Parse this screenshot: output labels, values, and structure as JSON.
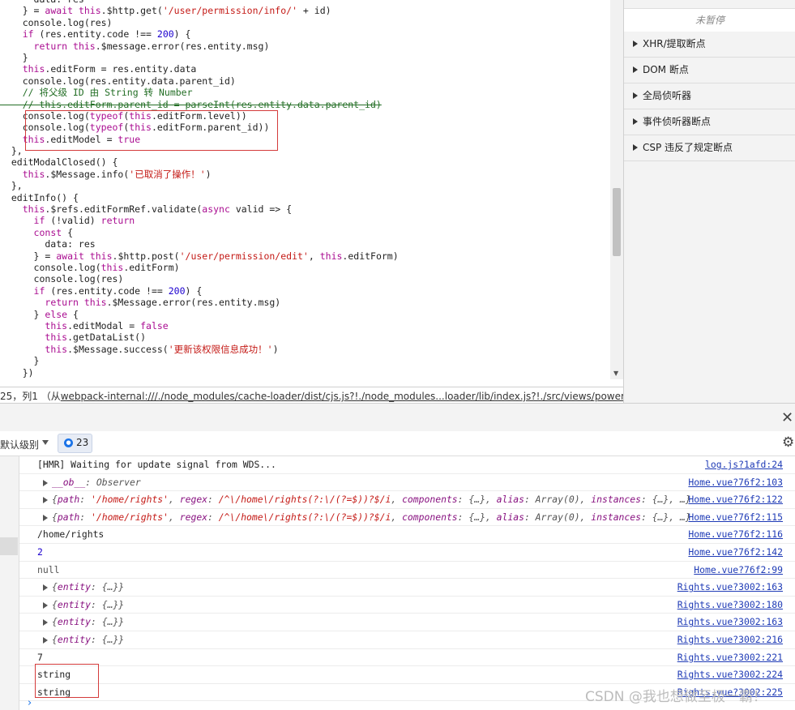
{
  "editor": {
    "lines": [
      [
        {
          "t": "      data: res"
        }
      ],
      [
        {
          "t": "    } = "
        },
        {
          "t": "await",
          "c": "kw"
        },
        {
          "t": " "
        },
        {
          "t": "this",
          "c": "kw"
        },
        {
          "t": ".$http.get("
        },
        {
          "t": "'/user/permission/info/'",
          "c": "str"
        },
        {
          "t": " + id)"
        }
      ],
      [
        {
          "t": "    console.log(res)"
        }
      ],
      [
        {
          "t": "    "
        },
        {
          "t": "if",
          "c": "kw"
        },
        {
          "t": " (res.entity.code !== "
        },
        {
          "t": "200",
          "c": "num"
        },
        {
          "t": ") {"
        }
      ],
      [
        {
          "t": "      "
        },
        {
          "t": "return",
          "c": "kw"
        },
        {
          "t": " "
        },
        {
          "t": "this",
          "c": "kw"
        },
        {
          "t": ".$message.error(res.entity.msg)"
        }
      ],
      [
        {
          "t": "    }"
        }
      ],
      [
        {
          "t": "    "
        },
        {
          "t": "this",
          "c": "kw"
        },
        {
          "t": ".editForm = res.entity.data"
        }
      ],
      [
        {
          "t": "    console.log(res.entity.data.parent_id)"
        }
      ],
      [
        {
          "t": "    // 将父级 ID 由 String 转 Number",
          "c": "cmt"
        }
      ],
      [
        {
          "t": "    // this.editForm.parent_id = parseInt(res.entity.data.parent_id)",
          "c": "cmt strike"
        }
      ],
      [
        {
          "t": "    console.log("
        },
        {
          "t": "typeof",
          "c": "kw"
        },
        {
          "t": "("
        },
        {
          "t": "this",
          "c": "kw"
        },
        {
          "t": ".editForm.level))"
        }
      ],
      [
        {
          "t": "    console.log("
        },
        {
          "t": "typeof",
          "c": "kw"
        },
        {
          "t": "("
        },
        {
          "t": "this",
          "c": "kw"
        },
        {
          "t": ".editForm.parent_id))"
        }
      ],
      [
        {
          "t": "    "
        },
        {
          "t": "this",
          "c": "kw"
        },
        {
          "t": ".editModel = "
        },
        {
          "t": "true",
          "c": "kw"
        }
      ],
      [
        {
          "t": "  },"
        }
      ],
      [
        {
          "t": "  editModalClosed() {"
        }
      ],
      [
        {
          "t": "    "
        },
        {
          "t": "this",
          "c": "kw"
        },
        {
          "t": ".$Message.info("
        },
        {
          "t": "'已取消了操作！'",
          "c": "str"
        },
        {
          "t": ")"
        }
      ],
      [
        {
          "t": "  },"
        }
      ],
      [
        {
          "t": "  editInfo() {"
        }
      ],
      [
        {
          "t": "    "
        },
        {
          "t": "this",
          "c": "kw"
        },
        {
          "t": ".$refs.editFormRef.validate("
        },
        {
          "t": "async",
          "c": "kw"
        },
        {
          "t": " valid => {"
        }
      ],
      [
        {
          "t": "      "
        },
        {
          "t": "if",
          "c": "kw"
        },
        {
          "t": " (!valid) "
        },
        {
          "t": "return",
          "c": "kw"
        }
      ],
      [
        {
          "t": "      "
        },
        {
          "t": "const",
          "c": "kw"
        },
        {
          "t": " {"
        }
      ],
      [
        {
          "t": "        data: res"
        }
      ],
      [
        {
          "t": "      } = "
        },
        {
          "t": "await",
          "c": "kw"
        },
        {
          "t": " "
        },
        {
          "t": "this",
          "c": "kw"
        },
        {
          "t": ".$http.post("
        },
        {
          "t": "'/user/permission/edit'",
          "c": "str"
        },
        {
          "t": ", "
        },
        {
          "t": "this",
          "c": "kw"
        },
        {
          "t": ".editForm)"
        }
      ],
      [
        {
          "t": "      console.log("
        },
        {
          "t": "this",
          "c": "kw"
        },
        {
          "t": ".editForm)"
        }
      ],
      [
        {
          "t": "      console.log(res)"
        }
      ],
      [
        {
          "t": "      "
        },
        {
          "t": "if",
          "c": "kw"
        },
        {
          "t": " (res.entity.code !== "
        },
        {
          "t": "200",
          "c": "num"
        },
        {
          "t": ") {"
        }
      ],
      [
        {
          "t": "        "
        },
        {
          "t": "return",
          "c": "kw"
        },
        {
          "t": " "
        },
        {
          "t": "this",
          "c": "kw"
        },
        {
          "t": ".$Message.error(res.entity.msg)"
        }
      ],
      [
        {
          "t": "      } "
        },
        {
          "t": "else",
          "c": "kw"
        },
        {
          "t": " {"
        }
      ],
      [
        {
          "t": "        "
        },
        {
          "t": "this",
          "c": "kw"
        },
        {
          "t": ".editModal = "
        },
        {
          "t": "false",
          "c": "kw"
        }
      ],
      [
        {
          "t": "        "
        },
        {
          "t": "this",
          "c": "kw"
        },
        {
          "t": ".getDataList()"
        }
      ],
      [
        {
          "t": "        "
        },
        {
          "t": "this",
          "c": "kw"
        },
        {
          "t": ".$Message.success("
        },
        {
          "t": "'更新该权限信息成功！'",
          "c": "str"
        },
        {
          "t": ")"
        }
      ],
      [
        {
          "t": "      }"
        }
      ],
      [
        {
          "t": "    })"
        }
      ]
    ],
    "scroll_position": 0.55
  },
  "status_bar": {
    "prefix": "25，列1 （从",
    "link": "webpack-internal:///./node_modules/cache-loader/dist/cjs.js?!./node_modules...loader/lib/index.js?!./src/views/power/Rights.vue?vue"
  },
  "sidebar": {
    "paused_label": "未暂停",
    "sections": [
      "XHR/提取断点",
      "DOM 断点",
      "全局侦听器",
      "事件侦听器断点",
      "CSP 违反了规定断点"
    ]
  },
  "drawer": {
    "close_glyph": "✕"
  },
  "console_toolbar": {
    "level_label": "默认级别",
    "issues_count": "23",
    "settings_glyph": "⚙"
  },
  "console": {
    "messages": [
      {
        "text": "[HMR] Waiting for update signal from WDS...",
        "src": "log.js?1afd:24"
      },
      {
        "expand": true,
        "style": "obj",
        "html": "<span class=\"k\">__ob__</span>: Observer",
        "src": "Home.vue?76f2:103"
      },
      {
        "expand": true,
        "style": "obj",
        "html": "{<span class=\"k\">path</span>: <span class=\"v\">'/home/rights'</span>, <span class=\"k\">regex</span>: <span class=\"v\">/^\\/home\\/rights(?:\\/(?=$))?$/i</span>, <span class=\"k\">components</span>: {…}, <span class=\"k\">alias</span>: Array(0), <span class=\"k\">instances</span>: {…}, …}",
        "src": "Home.vue?76f2:122"
      },
      {
        "expand": true,
        "style": "obj",
        "html": "{<span class=\"k\">path</span>: <span class=\"v\">'/home/rights'</span>, <span class=\"k\">regex</span>: <span class=\"v\">/^\\/home\\/rights(?:\\/(?=$))?$/i</span>, <span class=\"k\">components</span>: {…}, <span class=\"k\">alias</span>: Array(0), <span class=\"k\">instances</span>: {…}, …}",
        "src": "Home.vue?76f2:115"
      },
      {
        "text": "/home/rights",
        "src": "Home.vue?76f2:116"
      },
      {
        "text": "2",
        "style": "blue",
        "src": "Home.vue?76f2:142"
      },
      {
        "text": "null",
        "style": "gray",
        "src": "Home.vue?76f2:99"
      },
      {
        "expand": true,
        "style": "obj",
        "html": "{<span class=\"k\">entity</span>: {…}}",
        "src": "Rights.vue?3002:163"
      },
      {
        "expand": true,
        "style": "obj",
        "html": "{<span class=\"k\">entity</span>: {…}}",
        "src": "Rights.vue?3002:180"
      },
      {
        "expand": true,
        "style": "obj",
        "html": "{<span class=\"k\">entity</span>: {…}}",
        "src": "Rights.vue?3002:163"
      },
      {
        "expand": true,
        "style": "obj",
        "html": "{<span class=\"k\">entity</span>: {…}}",
        "src": "Rights.vue?3002:216"
      },
      {
        "text": "7",
        "src": "Rights.vue?3002:221"
      },
      {
        "text": "string",
        "src": "Rights.vue?3002:224"
      },
      {
        "text": "string",
        "src": "Rights.vue?3002:225"
      }
    ],
    "prompt_glyph": "›"
  },
  "watermark": "CSDN @我也想做至极一霸！"
}
